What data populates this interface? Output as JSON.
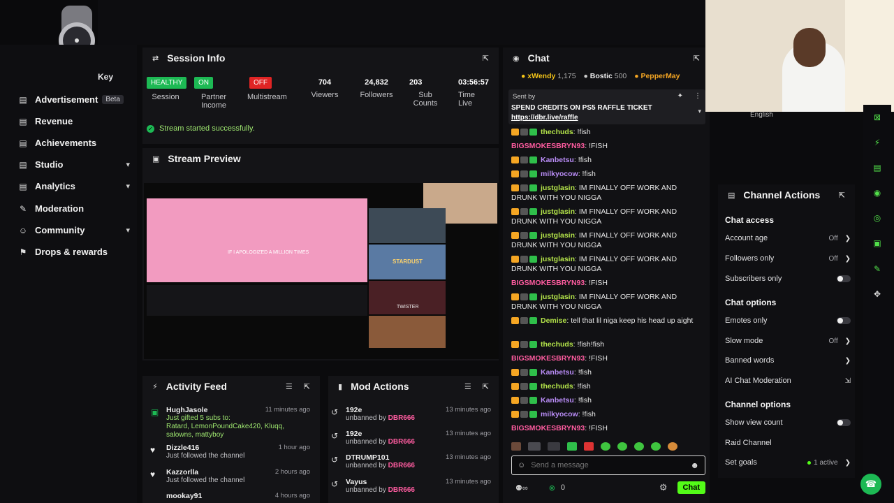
{
  "sidebar": {
    "partial_label": "Key",
    "items": [
      {
        "label": "Advertisement",
        "badge": "Beta",
        "icon": "list-icon"
      },
      {
        "label": "Revenue",
        "icon": "list-icon"
      },
      {
        "label": "Achievements",
        "icon": "list-icon"
      },
      {
        "label": "Studio",
        "icon": "list-icon",
        "chevron": "▾"
      },
      {
        "label": "Analytics",
        "icon": "list-icon",
        "chevron": "▾"
      },
      {
        "label": "Moderation",
        "icon": "wrench-icon"
      },
      {
        "label": "Community",
        "icon": "users-icon",
        "chevron": "▾"
      },
      {
        "label": "Drops & rewards",
        "icon": "gift-icon"
      }
    ]
  },
  "session": {
    "title": "Session Info",
    "stats": [
      {
        "badge": "HEALTHY",
        "badge_color": "#1db954",
        "label": "Session"
      },
      {
        "badge": "ON",
        "badge_color": "#1db954",
        "label": "Partner Income"
      },
      {
        "badge": "OFF",
        "badge_color": "#e02424",
        "label": "Multistream"
      },
      {
        "value": "704",
        "label": "Viewers"
      },
      {
        "value": "24,832",
        "label": "Followers"
      },
      {
        "value": "203",
        "label": "Sub Counts"
      },
      {
        "value": "03:56:57",
        "label": "Time Live"
      }
    ],
    "status": "Stream started successfully."
  },
  "preview": {
    "title": "Stream Preview",
    "video_caption": "IF I APOLOGIZED A MILLION TIMES",
    "thumb_texts": [
      "STARDUST",
      "TWISTER"
    ]
  },
  "activity": {
    "title": "Activity Feed",
    "items": [
      {
        "name": "HughJasole",
        "time": "11 minutes ago",
        "line1": "Just gifted 5 subs to:",
        "line2": "Ratard, LemonPoundCake420, Kluqq,",
        "line3": "salowns, mattyboy"
      },
      {
        "name": "Dizzle416",
        "time": "1 hour ago",
        "line1": "Just followed the channel"
      },
      {
        "name": "Kazzorlla",
        "time": "2 hours ago",
        "line1": "Just followed the channel"
      },
      {
        "name": "mookay91",
        "time": "4 hours ago"
      }
    ]
  },
  "mod": {
    "title": "Mod Actions",
    "items": [
      {
        "name": "192e",
        "action": "unbanned by",
        "mod": "DBR666",
        "time": "13 minutes ago"
      },
      {
        "name": "192e",
        "action": "unbanned by",
        "mod": "DBR666",
        "time": "13 minutes ago"
      },
      {
        "name": "DTRUMP101",
        "action": "unbanned by",
        "mod": "DBR666",
        "time": "13 minutes ago"
      },
      {
        "name": "Vayus",
        "action": "unbanned by",
        "mod": "DBR666",
        "time": "13 minutes ago"
      }
    ]
  },
  "chat": {
    "title": "Chat",
    "leaderboard": [
      {
        "name": "xWendy",
        "value": "1,175"
      },
      {
        "name": "Bostic",
        "value": "500"
      },
      {
        "name": "PepperMay",
        "value": ""
      }
    ],
    "pinned": {
      "sent_by": "Sent by",
      "message": "SPEND CREDITS ON PS5 RAFFLE TICKET",
      "link": "https://dbr.live/raffle"
    },
    "messages": [
      {
        "user": "thechuds",
        "color": "u-green",
        "text": "!fish"
      },
      {
        "user": "BIGSMOKESBRYN93",
        "color": "u-red",
        "text": "!FISH"
      },
      {
        "user": "Kanbetsu",
        "color": "u-purple",
        "text": "!fish"
      },
      {
        "user": "milkyocow",
        "color": "u-purple",
        "text": "!fish"
      },
      {
        "user": "justglasin",
        "color": "u-green",
        "text": "IM FINALLY OFF WORK AND DRUNK WITH YOU NIGGA"
      },
      {
        "user": "justglasin",
        "color": "u-green",
        "text": "IM FINALLY OFF WORK AND DRUNK WITH YOU NIGGA"
      },
      {
        "user": "justglasin",
        "color": "u-green",
        "text": "IM FINALLY OFF WORK AND DRUNK WITH YOU NIGGA"
      },
      {
        "user": "justglasin",
        "color": "u-green",
        "text": "IM FINALLY OFF WORK AND DRUNK WITH YOU NIGGA"
      },
      {
        "user": "BIGSMOKESBRYN93",
        "color": "u-red",
        "text": "!FISH"
      },
      {
        "user": "justglasin",
        "color": "u-green",
        "text": "IM FINALLY OFF WORK AND DRUNK WITH YOU NIGGA"
      },
      {
        "user": "Demise",
        "color": "u-green",
        "text": "tell that lil niga keep his head up aight"
      },
      {
        "user": "thechuds",
        "color": "u-green",
        "text": "!fish!fish"
      },
      {
        "user": "BIGSMOKESBRYN93",
        "color": "u-red",
        "text": "!FISH"
      },
      {
        "user": "Kanbetsu",
        "color": "u-purple",
        "text": "!fish"
      },
      {
        "user": "thechuds",
        "color": "u-green",
        "text": "!fish"
      },
      {
        "user": "Kanbetsu",
        "color": "u-purple",
        "text": "!fish"
      },
      {
        "user": "milkyocow",
        "color": "u-purple",
        "text": "!fish"
      },
      {
        "user": "BIGSMOKESBRYN93",
        "color": "u-red",
        "text": "!FISH"
      }
    ],
    "input_placeholder": "Send a message",
    "credits": "0",
    "send_label": "Chat"
  },
  "channel_actions": {
    "title": "Channel Actions",
    "language": "English",
    "sections": {
      "chat_access": "Chat access",
      "chat_options": "Chat options",
      "channel_options": "Channel options"
    },
    "rows": {
      "account_age": {
        "label": "Account age",
        "value": "Off"
      },
      "followers_only": {
        "label": "Followers only",
        "value": "Off"
      },
      "subscribers_only": {
        "label": "Subscribers only"
      },
      "emotes_only": {
        "label": "Emotes only"
      },
      "slow_mode": {
        "label": "Slow mode",
        "value": "Off"
      },
      "banned_words": {
        "label": "Banned words"
      },
      "ai_moderation": {
        "label": "AI Chat Moderation"
      },
      "show_view_count": {
        "label": "Show view count"
      },
      "raid_channel": {
        "label": "Raid Channel"
      },
      "set_goals": {
        "label": "Set goals",
        "value": "1 active"
      }
    }
  },
  "colors": {
    "accent": "#53fc18",
    "panel": "#141417",
    "background": "#0b0b0d"
  }
}
